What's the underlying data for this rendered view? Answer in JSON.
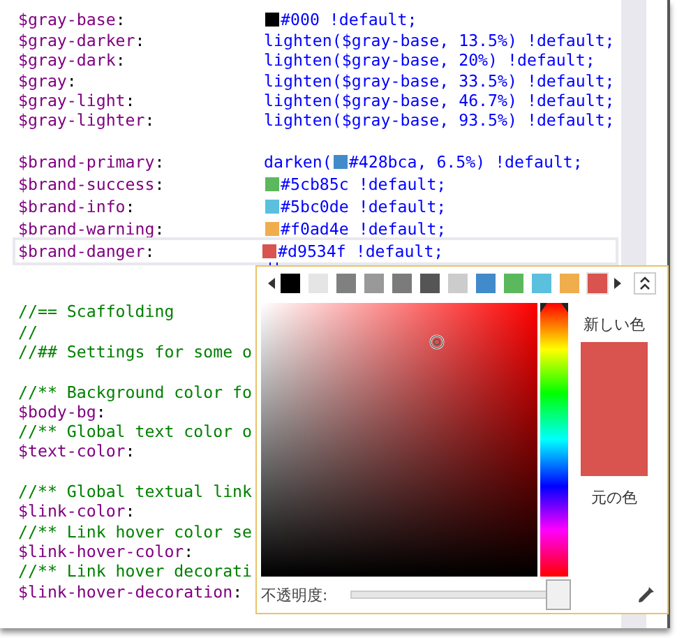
{
  "code_lines": [
    {
      "kind": "decl",
      "name": "$gray-base",
      "punct": ":",
      "color": "#000000",
      "value": "#000 !default;",
      "current": false
    },
    {
      "kind": "decl",
      "name": "$gray-darker",
      "punct": ":",
      "value": "lighten($gray-base, 13.5%) !default;",
      "current": false
    },
    {
      "kind": "decl",
      "name": "$gray-dark",
      "punct": ":",
      "value": "lighten($gray-base, 20%) !default;",
      "current": false
    },
    {
      "kind": "decl",
      "name": "$gray",
      "punct": ":",
      "value": "lighten($gray-base, 33.5%) !default;",
      "current": false
    },
    {
      "kind": "decl",
      "name": "$gray-light",
      "punct": ":",
      "value": "lighten($gray-base, 46.7%) !default;",
      "current": false
    },
    {
      "kind": "decl",
      "name": "$gray-lighter",
      "punct": ":",
      "value": "lighten($gray-base, 93.5%) !default;",
      "current": false
    },
    {
      "kind": "blank"
    },
    {
      "kind": "decl",
      "name": "$brand-primary",
      "punct": ":",
      "prefix": "darken(",
      "color": "#428bca",
      "value": "#428bca, 6.5%) !default;",
      "current": false
    },
    {
      "kind": "decl",
      "name": "$brand-success",
      "punct": ":",
      "color": "#5cb85c",
      "value": "#5cb85c !default;",
      "current": false
    },
    {
      "kind": "decl",
      "name": "$brand-info",
      "punct": ":",
      "color": "#5bc0de",
      "value": "#5bc0de !default;",
      "current": false
    },
    {
      "kind": "decl",
      "name": "$brand-warning",
      "punct": ":",
      "color": "#f0ad4e",
      "value": "#f0ad4e !default;",
      "current": false
    },
    {
      "kind": "decl",
      "name": "$brand-danger",
      "punct": ":",
      "color": "#d9534f",
      "value": "#d9534f !default;",
      "current": true
    },
    {
      "kind": "blank"
    },
    {
      "kind": "blank"
    },
    {
      "kind": "comment",
      "text": "//== Scaffolding"
    },
    {
      "kind": "comment",
      "text": "//"
    },
    {
      "kind": "comment",
      "text": "//## Settings for some o"
    },
    {
      "kind": "blank"
    },
    {
      "kind": "comment",
      "text": "//** Background color fo"
    },
    {
      "kind": "decl",
      "name": "$body-bg",
      "punct": ":",
      "current": false
    },
    {
      "kind": "comment",
      "text": "//** Global text color o"
    },
    {
      "kind": "decl",
      "name": "$text-color",
      "punct": ":",
      "current": false
    },
    {
      "kind": "blank"
    },
    {
      "kind": "comment",
      "text": "//** Global textual link"
    },
    {
      "kind": "decl",
      "name": "$link-color",
      "punct": ":",
      "current": false
    },
    {
      "kind": "comment",
      "text": "//** Link hover color se"
    },
    {
      "kind": "decl",
      "name": "$link-hover-color",
      "punct": ":",
      "current": false
    },
    {
      "kind": "comment",
      "text": "//** Link hover decorati"
    },
    {
      "kind": "decl",
      "name": "$link-hover-decoration",
      "punct": ":",
      "current": false
    }
  ],
  "color_picker": {
    "swatches": [
      {
        "color": "#000000",
        "selected": false
      },
      {
        "color": "#e5e5e5",
        "selected": false
      },
      {
        "color": "#808080",
        "selected": false
      },
      {
        "color": "#999999",
        "selected": false
      },
      {
        "color": "#7b7b7b",
        "selected": false
      },
      {
        "color": "#555555",
        "selected": false
      },
      {
        "color": "#cccccc",
        "selected": false
      },
      {
        "color": "#428bca",
        "selected": false
      },
      {
        "color": "#5cb85c",
        "selected": false
      },
      {
        "color": "#5bc0de",
        "selected": false
      },
      {
        "color": "#f0ad4e",
        "selected": false
      },
      {
        "color": "#d9534f",
        "selected": true
      }
    ],
    "new_label": "新しい色",
    "old_label": "元の色",
    "opacity_label": "不透明度:",
    "hue": {
      "level": 0
    },
    "opacity": {
      "level": 1
    }
  }
}
